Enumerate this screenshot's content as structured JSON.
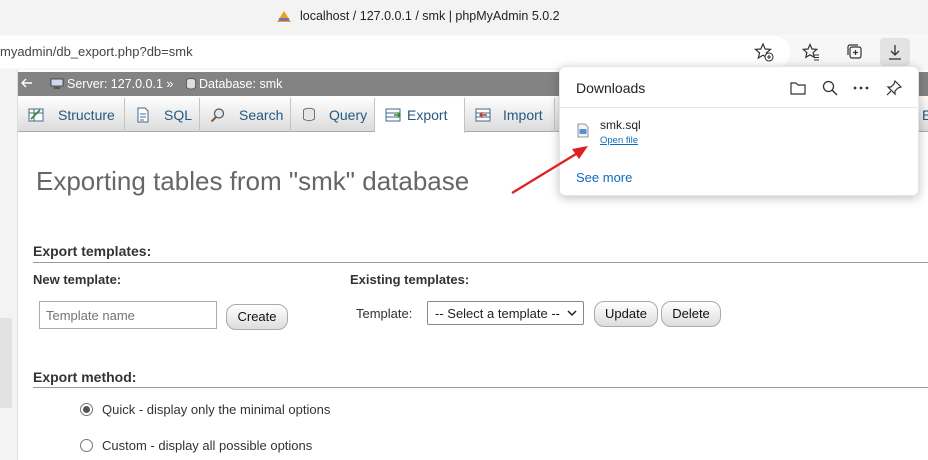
{
  "browser": {
    "tab_title": "localhost / 127.0.0.1 / smk | phpMyAdmin 5.0.2",
    "url": "myadmin/db_export.php?db=smk"
  },
  "breadcrumb": {
    "server": "Server: 127.0.0.1 »",
    "database": "Database: smk"
  },
  "tabs": [
    {
      "label": "Structure",
      "icon": "structure-icon"
    },
    {
      "label": "SQL",
      "icon": "sql-icon"
    },
    {
      "label": "Search",
      "icon": "search-icon"
    },
    {
      "label": "Query",
      "icon": "query-icon"
    },
    {
      "label": "Export",
      "icon": "export-icon",
      "active": true
    },
    {
      "label": "Import",
      "icon": "import-icon"
    }
  ],
  "page": {
    "heading": "Exporting tables from \"smk\" database",
    "export_templates": {
      "title": "Export templates:",
      "new_template_title": "New template:",
      "template_name_placeholder": "Template name",
      "create_label": "Create",
      "existing_title": "Existing templates:",
      "template_label": "Template:",
      "select_value": "-- Select a template --",
      "update_label": "Update",
      "delete_label": "Delete"
    },
    "export_method": {
      "title": "Export method:",
      "options": [
        {
          "label": "Quick - display only the minimal options",
          "checked": true
        },
        {
          "label": "Custom - display all possible options",
          "checked": false
        }
      ]
    }
  },
  "downloads": {
    "title": "Downloads",
    "file_name": "smk.sql",
    "open_file": "Open file",
    "see_more": "See more"
  },
  "colors": {
    "accent_link": "#0f6cbd",
    "tab_text": "#235a81",
    "arrow": "#e02020"
  }
}
